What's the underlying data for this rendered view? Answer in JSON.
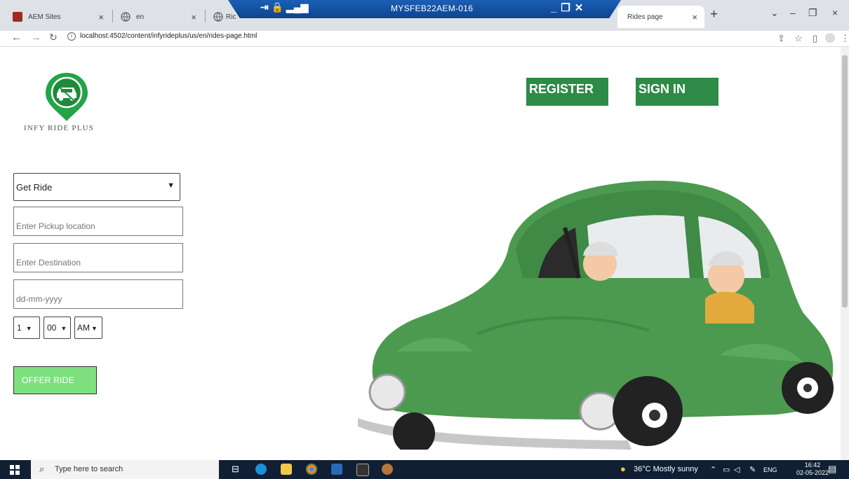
{
  "tabs": [
    {
      "label": "AEM Sites",
      "close": "×"
    },
    {
      "label": "en",
      "close": "×"
    },
    {
      "label": "Ric"
    },
    {
      "label": "Rides page",
      "close": "×"
    }
  ],
  "new_tab": "+",
  "remote_session": {
    "title": "MYSFEB22AEM-016"
  },
  "window_controls": {
    "chevron": "⌄",
    "minimize": "–",
    "restore": "❐",
    "close": "×"
  },
  "address": {
    "url": "localhost:4502/content/infyrideplus/us/en/rides-page.html"
  },
  "brand": {
    "name": "INFY RIDE PLUS"
  },
  "header": {
    "register": "REGISTER",
    "signin": "SIGN IN"
  },
  "form": {
    "ride_type": "Get Ride",
    "pickup_placeholder": "Enter Pickup location",
    "destination_placeholder": "Enter Destination",
    "date_placeholder": "dd-mm-yyyy",
    "hour": "1",
    "minute": "00",
    "ampm": "AM",
    "offer_button": "OFFER RIDE"
  },
  "taskbar": {
    "search_placeholder": "Type here to search",
    "weather": "36°C  Mostly sunny",
    "lang": "ENG",
    "time": "16:42",
    "date": "02-05-2022"
  },
  "colors": {
    "brand_green": "#2e8b47",
    "offer_green": "#7ee07f",
    "car_green": "#4c9a50"
  }
}
